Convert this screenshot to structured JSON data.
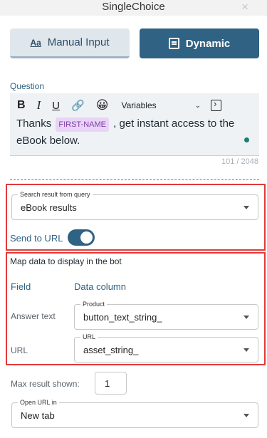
{
  "header": {
    "title": "SingleChoice",
    "close_icon": "×"
  },
  "tabs": [
    {
      "label": "Manual Input",
      "icon": "Aa",
      "active": false
    },
    {
      "label": "Dynamic",
      "icon": "document-code-icon",
      "active": true
    }
  ],
  "question": {
    "label": "Question",
    "toolbar": {
      "bold": "B",
      "italic": "I",
      "underline": "U",
      "link": "🔗",
      "emoji": "😀",
      "variables": "Variables",
      "caret": "⌄"
    },
    "text_before": "Thanks ",
    "variable_chip": "FIRST-NAME",
    "text_after": " , get instant access to the eBook below.",
    "counter": "101 / 2048"
  },
  "query": {
    "legend": "Search result from query",
    "value": "eBook results"
  },
  "send_to_url": {
    "label": "Send to URL",
    "enabled": true
  },
  "mapping": {
    "title": "Map data to display in the bot",
    "col_field": "Field",
    "col_data": "Data column",
    "rows": [
      {
        "field": "Answer text",
        "legend": "Product",
        "value": "button_text_string_"
      },
      {
        "field": "URL",
        "legend": "URL",
        "value": "asset_string_"
      }
    ]
  },
  "max_result": {
    "label": "Max result shown:",
    "value": "1"
  },
  "open_url": {
    "legend": "Open URL in",
    "value": "New tab"
  },
  "colors": {
    "accent": "#2f6283",
    "highlight_border": "#e23a3a",
    "chip_bg": "#e9d4f7"
  }
}
